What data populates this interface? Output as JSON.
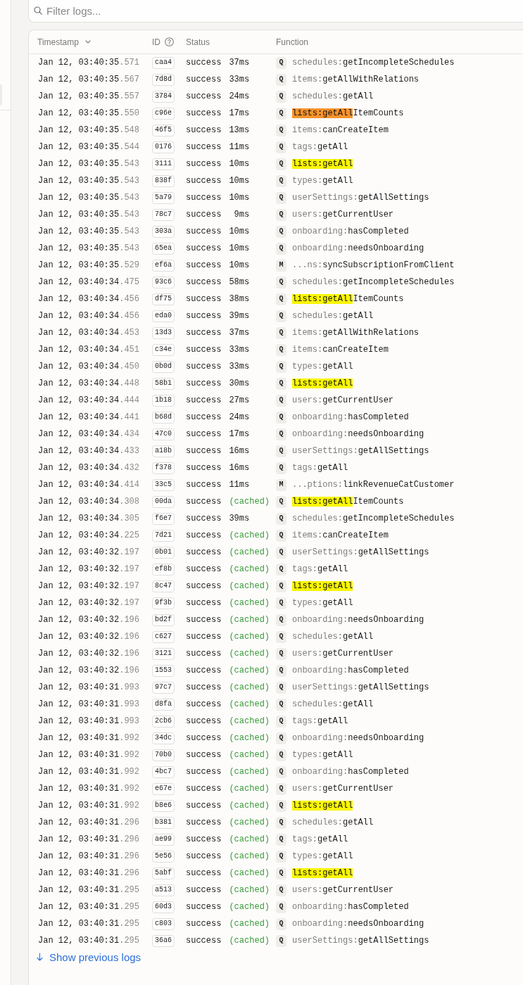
{
  "search": {
    "placeholder": "Filter logs..."
  },
  "table": {
    "columns": [
      {
        "label": "Timestamp",
        "kind": "sortable"
      },
      {
        "label": "ID",
        "kind": "help"
      },
      {
        "label": "Status",
        "kind": "plain"
      },
      {
        "label": "Function",
        "kind": "plain"
      }
    ],
    "rows": [
      {
        "time": "Jan 12, 03:40:35",
        "ms": ".571",
        "id": "caa4",
        "status": "success",
        "duration": "37ms",
        "cached": false,
        "type": "Q",
        "function": [
          {
            "text": "schedules:",
            "kind": "module"
          },
          {
            "text": "getIncompleteSchedules",
            "kind": "name"
          }
        ]
      },
      {
        "time": "Jan 12, 03:40:35",
        "ms": ".567",
        "id": "7d8d",
        "status": "success",
        "duration": "33ms",
        "cached": false,
        "type": "Q",
        "function": [
          {
            "text": "items:",
            "kind": "module"
          },
          {
            "text": "getAllWithRelations",
            "kind": "name"
          }
        ]
      },
      {
        "time": "Jan 12, 03:40:35",
        "ms": ".557",
        "id": "3784",
        "status": "success",
        "duration": "24ms",
        "cached": false,
        "type": "Q",
        "function": [
          {
            "text": "schedules:",
            "kind": "module"
          },
          {
            "text": "getAll",
            "kind": "name"
          }
        ]
      },
      {
        "time": "Jan 12, 03:40:35",
        "ms": ".550",
        "id": "c96e",
        "status": "success",
        "duration": "17ms",
        "cached": false,
        "type": "Q",
        "function": [
          {
            "text": "lists:getAll",
            "kind": "current_match"
          },
          {
            "text": "ItemCounts",
            "kind": "name"
          }
        ]
      },
      {
        "time": "Jan 12, 03:40:35",
        "ms": ".548",
        "id": "46f5",
        "status": "success",
        "duration": "13ms",
        "cached": false,
        "type": "Q",
        "function": [
          {
            "text": "items:",
            "kind": "module"
          },
          {
            "text": "canCreateItem",
            "kind": "name"
          }
        ]
      },
      {
        "time": "Jan 12, 03:40:35",
        "ms": ".544",
        "id": "0176",
        "status": "success",
        "duration": "11ms",
        "cached": false,
        "type": "Q",
        "function": [
          {
            "text": "tags:",
            "kind": "module"
          },
          {
            "text": "getAll",
            "kind": "name"
          }
        ]
      },
      {
        "time": "Jan 12, 03:40:35",
        "ms": ".543",
        "id": "3111",
        "status": "success",
        "duration": "10ms",
        "cached": false,
        "type": "Q",
        "function": [
          {
            "text": "lists:getAll",
            "kind": "match"
          }
        ]
      },
      {
        "time": "Jan 12, 03:40:35",
        "ms": ".543",
        "id": "838f",
        "status": "success",
        "duration": "10ms",
        "cached": false,
        "type": "Q",
        "function": [
          {
            "text": "types:",
            "kind": "module"
          },
          {
            "text": "getAll",
            "kind": "name"
          }
        ]
      },
      {
        "time": "Jan 12, 03:40:35",
        "ms": ".543",
        "id": "5a79",
        "status": "success",
        "duration": "10ms",
        "cached": false,
        "type": "Q",
        "function": [
          {
            "text": "userSettings:",
            "kind": "module"
          },
          {
            "text": "getAllSettings",
            "kind": "name"
          }
        ]
      },
      {
        "time": "Jan 12, 03:40:35",
        "ms": ".543",
        "id": "78c7",
        "status": "success",
        "duration": "9ms",
        "cached": false,
        "type": "Q",
        "function": [
          {
            "text": "users:",
            "kind": "module"
          },
          {
            "text": "getCurrentUser",
            "kind": "name"
          }
        ]
      },
      {
        "time": "Jan 12, 03:40:35",
        "ms": ".543",
        "id": "303a",
        "status": "success",
        "duration": "10ms",
        "cached": false,
        "type": "Q",
        "function": [
          {
            "text": "onboarding:",
            "kind": "module"
          },
          {
            "text": "hasCompleted",
            "kind": "name"
          }
        ]
      },
      {
        "time": "Jan 12, 03:40:35",
        "ms": ".543",
        "id": "65ea",
        "status": "success",
        "duration": "10ms",
        "cached": false,
        "type": "Q",
        "function": [
          {
            "text": "onboarding:",
            "kind": "module"
          },
          {
            "text": "needsOnboarding",
            "kind": "name"
          }
        ]
      },
      {
        "time": "Jan 12, 03:40:35",
        "ms": ".529",
        "id": "ef6a",
        "status": "success",
        "duration": "10ms",
        "cached": false,
        "type": "M",
        "function": [
          {
            "text": "...ns:",
            "kind": "module"
          },
          {
            "text": "syncSubscriptionFromClient",
            "kind": "name"
          }
        ]
      },
      {
        "time": "Jan 12, 03:40:34",
        "ms": ".475",
        "id": "93c6",
        "status": "success",
        "duration": "58ms",
        "cached": false,
        "type": "Q",
        "function": [
          {
            "text": "schedules:",
            "kind": "module"
          },
          {
            "text": "getIncompleteSchedules",
            "kind": "name"
          }
        ]
      },
      {
        "time": "Jan 12, 03:40:34",
        "ms": ".456",
        "id": "df75",
        "status": "success",
        "duration": "38ms",
        "cached": false,
        "type": "Q",
        "function": [
          {
            "text": "lists:getAll",
            "kind": "match"
          },
          {
            "text": "ItemCounts",
            "kind": "name"
          }
        ]
      },
      {
        "time": "Jan 12, 03:40:34",
        "ms": ".456",
        "id": "eda0",
        "status": "success",
        "duration": "39ms",
        "cached": false,
        "type": "Q",
        "function": [
          {
            "text": "schedules:",
            "kind": "module"
          },
          {
            "text": "getAll",
            "kind": "name"
          }
        ]
      },
      {
        "time": "Jan 12, 03:40:34",
        "ms": ".453",
        "id": "13d3",
        "status": "success",
        "duration": "37ms",
        "cached": false,
        "type": "Q",
        "function": [
          {
            "text": "items:",
            "kind": "module"
          },
          {
            "text": "getAllWithRelations",
            "kind": "name"
          }
        ]
      },
      {
        "time": "Jan 12, 03:40:34",
        "ms": ".451",
        "id": "c34e",
        "status": "success",
        "duration": "33ms",
        "cached": false,
        "type": "Q",
        "function": [
          {
            "text": "items:",
            "kind": "module"
          },
          {
            "text": "canCreateItem",
            "kind": "name"
          }
        ]
      },
      {
        "time": "Jan 12, 03:40:34",
        "ms": ".450",
        "id": "0b0d",
        "status": "success",
        "duration": "33ms",
        "cached": false,
        "type": "Q",
        "function": [
          {
            "text": "types:",
            "kind": "module"
          },
          {
            "text": "getAll",
            "kind": "name"
          }
        ]
      },
      {
        "time": "Jan 12, 03:40:34",
        "ms": ".448",
        "id": "58b1",
        "status": "success",
        "duration": "30ms",
        "cached": false,
        "type": "Q",
        "function": [
          {
            "text": "lists:getAll",
            "kind": "match"
          }
        ]
      },
      {
        "time": "Jan 12, 03:40:34",
        "ms": ".444",
        "id": "1b18",
        "status": "success",
        "duration": "27ms",
        "cached": false,
        "type": "Q",
        "function": [
          {
            "text": "users:",
            "kind": "module"
          },
          {
            "text": "getCurrentUser",
            "kind": "name"
          }
        ]
      },
      {
        "time": "Jan 12, 03:40:34",
        "ms": ".441",
        "id": "b68d",
        "status": "success",
        "duration": "24ms",
        "cached": false,
        "type": "Q",
        "function": [
          {
            "text": "onboarding:",
            "kind": "module"
          },
          {
            "text": "hasCompleted",
            "kind": "name"
          }
        ]
      },
      {
        "time": "Jan 12, 03:40:34",
        "ms": ".434",
        "id": "47c0",
        "status": "success",
        "duration": "17ms",
        "cached": false,
        "type": "Q",
        "function": [
          {
            "text": "onboarding:",
            "kind": "module"
          },
          {
            "text": "needsOnboarding",
            "kind": "name"
          }
        ]
      },
      {
        "time": "Jan 12, 03:40:34",
        "ms": ".433",
        "id": "a18b",
        "status": "success",
        "duration": "16ms",
        "cached": false,
        "type": "Q",
        "function": [
          {
            "text": "userSettings:",
            "kind": "module"
          },
          {
            "text": "getAllSettings",
            "kind": "name"
          }
        ]
      },
      {
        "time": "Jan 12, 03:40:34",
        "ms": ".432",
        "id": "f378",
        "status": "success",
        "duration": "16ms",
        "cached": false,
        "type": "Q",
        "function": [
          {
            "text": "tags:",
            "kind": "module"
          },
          {
            "text": "getAll",
            "kind": "name"
          }
        ]
      },
      {
        "time": "Jan 12, 03:40:34",
        "ms": ".414",
        "id": "33c5",
        "status": "success",
        "duration": "11ms",
        "cached": false,
        "type": "M",
        "function": [
          {
            "text": "...ptions:",
            "kind": "module"
          },
          {
            "text": "linkRevenueCatCustomer",
            "kind": "name"
          }
        ]
      },
      {
        "time": "Jan 12, 03:40:34",
        "ms": ".308",
        "id": "00da",
        "status": "success",
        "duration": "(cached)",
        "cached": true,
        "type": "Q",
        "function": [
          {
            "text": "lists:getAll",
            "kind": "match"
          },
          {
            "text": "ItemCounts",
            "kind": "name"
          }
        ]
      },
      {
        "time": "Jan 12, 03:40:34",
        "ms": ".305",
        "id": "f6e7",
        "status": "success",
        "duration": "39ms",
        "cached": false,
        "type": "Q",
        "function": [
          {
            "text": "schedules:",
            "kind": "module"
          },
          {
            "text": "getIncompleteSchedules",
            "kind": "name"
          }
        ]
      },
      {
        "time": "Jan 12, 03:40:34",
        "ms": ".225",
        "id": "7d21",
        "status": "success",
        "duration": "(cached)",
        "cached": true,
        "type": "Q",
        "function": [
          {
            "text": "items:",
            "kind": "module"
          },
          {
            "text": "canCreateItem",
            "kind": "name"
          }
        ]
      },
      {
        "time": "Jan 12, 03:40:32",
        "ms": ".197",
        "id": "0b01",
        "status": "success",
        "duration": "(cached)",
        "cached": true,
        "type": "Q",
        "function": [
          {
            "text": "userSettings:",
            "kind": "module"
          },
          {
            "text": "getAllSettings",
            "kind": "name"
          }
        ]
      },
      {
        "time": "Jan 12, 03:40:32",
        "ms": ".197",
        "id": "ef8b",
        "status": "success",
        "duration": "(cached)",
        "cached": true,
        "type": "Q",
        "function": [
          {
            "text": "tags:",
            "kind": "module"
          },
          {
            "text": "getAll",
            "kind": "name"
          }
        ]
      },
      {
        "time": "Jan 12, 03:40:32",
        "ms": ".197",
        "id": "8c47",
        "status": "success",
        "duration": "(cached)",
        "cached": true,
        "type": "Q",
        "function": [
          {
            "text": "lists:getAll",
            "kind": "match"
          }
        ]
      },
      {
        "time": "Jan 12, 03:40:32",
        "ms": ".197",
        "id": "9f3b",
        "status": "success",
        "duration": "(cached)",
        "cached": true,
        "type": "Q",
        "function": [
          {
            "text": "types:",
            "kind": "module"
          },
          {
            "text": "getAll",
            "kind": "name"
          }
        ]
      },
      {
        "time": "Jan 12, 03:40:32",
        "ms": ".196",
        "id": "bd2f",
        "status": "success",
        "duration": "(cached)",
        "cached": true,
        "type": "Q",
        "function": [
          {
            "text": "onboarding:",
            "kind": "module"
          },
          {
            "text": "needsOnboarding",
            "kind": "name"
          }
        ]
      },
      {
        "time": "Jan 12, 03:40:32",
        "ms": ".196",
        "id": "c627",
        "status": "success",
        "duration": "(cached)",
        "cached": true,
        "type": "Q",
        "function": [
          {
            "text": "schedules:",
            "kind": "module"
          },
          {
            "text": "getAll",
            "kind": "name"
          }
        ]
      },
      {
        "time": "Jan 12, 03:40:32",
        "ms": ".196",
        "id": "3121",
        "status": "success",
        "duration": "(cached)",
        "cached": true,
        "type": "Q",
        "function": [
          {
            "text": "users:",
            "kind": "module"
          },
          {
            "text": "getCurrentUser",
            "kind": "name"
          }
        ]
      },
      {
        "time": "Jan 12, 03:40:32",
        "ms": ".196",
        "id": "1553",
        "status": "success",
        "duration": "(cached)",
        "cached": true,
        "type": "Q",
        "function": [
          {
            "text": "onboarding:",
            "kind": "module"
          },
          {
            "text": "hasCompleted",
            "kind": "name"
          }
        ]
      },
      {
        "time": "Jan 12, 03:40:31",
        "ms": ".993",
        "id": "97c7",
        "status": "success",
        "duration": "(cached)",
        "cached": true,
        "type": "Q",
        "function": [
          {
            "text": "userSettings:",
            "kind": "module"
          },
          {
            "text": "getAllSettings",
            "kind": "name"
          }
        ]
      },
      {
        "time": "Jan 12, 03:40:31",
        "ms": ".993",
        "id": "d8fa",
        "status": "success",
        "duration": "(cached)",
        "cached": true,
        "type": "Q",
        "function": [
          {
            "text": "schedules:",
            "kind": "module"
          },
          {
            "text": "getAll",
            "kind": "name"
          }
        ]
      },
      {
        "time": "Jan 12, 03:40:31",
        "ms": ".993",
        "id": "2cb6",
        "status": "success",
        "duration": "(cached)",
        "cached": true,
        "type": "Q",
        "function": [
          {
            "text": "tags:",
            "kind": "module"
          },
          {
            "text": "getAll",
            "kind": "name"
          }
        ]
      },
      {
        "time": "Jan 12, 03:40:31",
        "ms": ".992",
        "id": "34dc",
        "status": "success",
        "duration": "(cached)",
        "cached": true,
        "type": "Q",
        "function": [
          {
            "text": "onboarding:",
            "kind": "module"
          },
          {
            "text": "needsOnboarding",
            "kind": "name"
          }
        ]
      },
      {
        "time": "Jan 12, 03:40:31",
        "ms": ".992",
        "id": "70b0",
        "status": "success",
        "duration": "(cached)",
        "cached": true,
        "type": "Q",
        "function": [
          {
            "text": "types:",
            "kind": "module"
          },
          {
            "text": "getAll",
            "kind": "name"
          }
        ]
      },
      {
        "time": "Jan 12, 03:40:31",
        "ms": ".992",
        "id": "4bc7",
        "status": "success",
        "duration": "(cached)",
        "cached": true,
        "type": "Q",
        "function": [
          {
            "text": "onboarding:",
            "kind": "module"
          },
          {
            "text": "hasCompleted",
            "kind": "name"
          }
        ]
      },
      {
        "time": "Jan 12, 03:40:31",
        "ms": ".992",
        "id": "e67e",
        "status": "success",
        "duration": "(cached)",
        "cached": true,
        "type": "Q",
        "function": [
          {
            "text": "users:",
            "kind": "module"
          },
          {
            "text": "getCurrentUser",
            "kind": "name"
          }
        ]
      },
      {
        "time": "Jan 12, 03:40:31",
        "ms": ".992",
        "id": "b8e6",
        "status": "success",
        "duration": "(cached)",
        "cached": true,
        "type": "Q",
        "function": [
          {
            "text": "lists:getAll",
            "kind": "match"
          }
        ]
      },
      {
        "time": "Jan 12, 03:40:31",
        "ms": ".296",
        "id": "b381",
        "status": "success",
        "duration": "(cached)",
        "cached": true,
        "type": "Q",
        "function": [
          {
            "text": "schedules:",
            "kind": "module"
          },
          {
            "text": "getAll",
            "kind": "name"
          }
        ]
      },
      {
        "time": "Jan 12, 03:40:31",
        "ms": ".296",
        "id": "ae99",
        "status": "success",
        "duration": "(cached)",
        "cached": true,
        "type": "Q",
        "function": [
          {
            "text": "tags:",
            "kind": "module"
          },
          {
            "text": "getAll",
            "kind": "name"
          }
        ]
      },
      {
        "time": "Jan 12, 03:40:31",
        "ms": ".296",
        "id": "5e56",
        "status": "success",
        "duration": "(cached)",
        "cached": true,
        "type": "Q",
        "function": [
          {
            "text": "types:",
            "kind": "module"
          },
          {
            "text": "getAll",
            "kind": "name"
          }
        ]
      },
      {
        "time": "Jan 12, 03:40:31",
        "ms": ".296",
        "id": "5abf",
        "status": "success",
        "duration": "(cached)",
        "cached": true,
        "type": "Q",
        "function": [
          {
            "text": "lists:getAll",
            "kind": "match"
          }
        ]
      },
      {
        "time": "Jan 12, 03:40:31",
        "ms": ".295",
        "id": "a513",
        "status": "success",
        "duration": "(cached)",
        "cached": true,
        "type": "Q",
        "function": [
          {
            "text": "users:",
            "kind": "module"
          },
          {
            "text": "getCurrentUser",
            "kind": "name"
          }
        ]
      },
      {
        "time": "Jan 12, 03:40:31",
        "ms": ".295",
        "id": "60d3",
        "status": "success",
        "duration": "(cached)",
        "cached": true,
        "type": "Q",
        "function": [
          {
            "text": "onboarding:",
            "kind": "module"
          },
          {
            "text": "hasCompleted",
            "kind": "name"
          }
        ]
      },
      {
        "time": "Jan 12, 03:40:31",
        "ms": ".295",
        "id": "c803",
        "status": "success",
        "duration": "(cached)",
        "cached": true,
        "type": "Q",
        "function": [
          {
            "text": "onboarding:",
            "kind": "module"
          },
          {
            "text": "needsOnboarding",
            "kind": "name"
          }
        ]
      },
      {
        "time": "Jan 12, 03:40:31",
        "ms": ".295",
        "id": "36a6",
        "status": "success",
        "duration": "(cached)",
        "cached": true,
        "type": "Q",
        "function": [
          {
            "text": "userSettings:",
            "kind": "module"
          },
          {
            "text": "getAllSettings",
            "kind": "name"
          }
        ]
      }
    ]
  },
  "footer": {
    "label": "Show previous logs"
  }
}
